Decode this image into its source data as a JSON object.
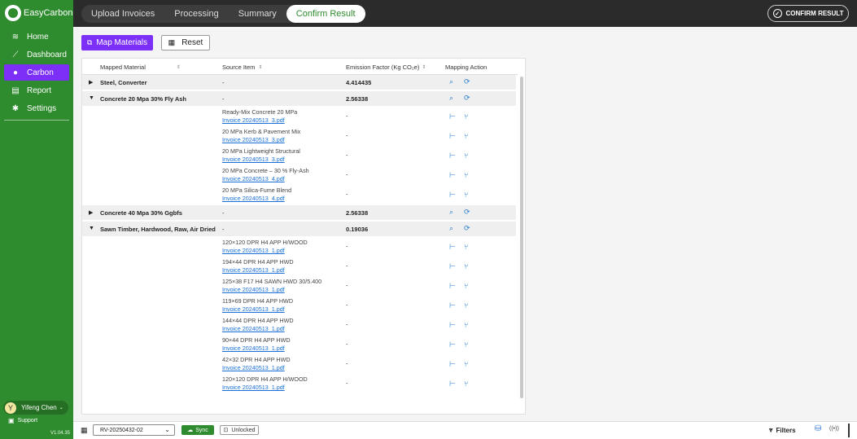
{
  "app": {
    "name": "EasyCarbon",
    "version": "V1.04.35"
  },
  "sidebar": {
    "items": [
      {
        "label": "Home",
        "icon": "layers-icon"
      },
      {
        "label": "Dashboard",
        "icon": "chart-line-icon"
      },
      {
        "label": "Carbon",
        "icon": "droplet-icon",
        "active": true
      },
      {
        "label": "Report",
        "icon": "document-icon"
      },
      {
        "label": "Settings",
        "icon": "gear-icon"
      }
    ],
    "user": {
      "initial": "Y",
      "name": "Yifeng Chen"
    },
    "support_label": "Support"
  },
  "header": {
    "tabs": [
      {
        "label": "Upload Invoices"
      },
      {
        "label": "Processing"
      },
      {
        "label": "Summary"
      },
      {
        "label": "Confirm Result",
        "active": true
      }
    ],
    "confirm_button": "CONFIRM RESULT"
  },
  "toolbar": {
    "map_materials": "Map Materials",
    "reset": "Reset"
  },
  "table": {
    "columns": {
      "mapped_material": "Mapped Material",
      "source_item": "Source Item",
      "emission_factor": "Emission Factor (Kg CO₂e)",
      "mapping_action": "Mapping Action"
    },
    "groups": [
      {
        "material": "Steel, Converter",
        "source": "-",
        "factor": "4.414435",
        "expanded": false,
        "items": []
      },
      {
        "material": "Concrete 20 Mpa 30% Fly Ash",
        "source": "-",
        "factor": "2.56338",
        "expanded": true,
        "items": [
          {
            "name": "Ready-Mix Concrete 20 MPa",
            "invoice": "Invoice 20240513_3.pdf",
            "factor": "-"
          },
          {
            "name": "20 MPa Kerb & Pavement Mix",
            "invoice": "Invoice 20240513_3.pdf",
            "factor": "-"
          },
          {
            "name": "20 MPa Lightweight Structural",
            "invoice": "Invoice 20240513_3.pdf",
            "factor": "-"
          },
          {
            "name": "20 MPa Concrete – 30 % Fly-Ash",
            "invoice": "Invoice 20240513_4.pdf",
            "factor": "-"
          },
          {
            "name": "20 MPa Silica-Fume Blend",
            "invoice": "Invoice 20240513_4.pdf",
            "factor": "-"
          }
        ]
      },
      {
        "material": "Concrete 40 Mpa 30% Ggbfs",
        "source": "-",
        "factor": "2.56338",
        "expanded": false,
        "items": []
      },
      {
        "material": "Sawn Timber, Hardwood, Raw, Air Dried",
        "source": "-",
        "factor": "0.19036",
        "expanded": true,
        "items": [
          {
            "name": "120×120 DPR H4 APP H/WOOD",
            "invoice": "Invoice 20240513_1.pdf",
            "factor": "-"
          },
          {
            "name": "194×44 DPR H4 APP HWD",
            "invoice": "Invoice 20240513_1.pdf",
            "factor": "-"
          },
          {
            "name": "125×38 F17 H4 SAWN HWD 30/5.400",
            "invoice": "Invoice 20240513_1.pdf",
            "factor": "-"
          },
          {
            "name": "119×69 DPR H4 APP HWD",
            "invoice": "Invoice 20240513_1.pdf",
            "factor": "-"
          },
          {
            "name": "144×44 DPR H4 APP HWD",
            "invoice": "Invoice 20240513_1.pdf",
            "factor": "-"
          },
          {
            "name": "90×44 DPR H4 APP HWD",
            "invoice": "Invoice 20240513_1.pdf",
            "factor": "-"
          },
          {
            "name": "42×32 DPR H4 APP HWD",
            "invoice": "Invoice 20240513_1.pdf",
            "factor": "-"
          },
          {
            "name": "120×120 DPR H4 APP H/WOOD",
            "invoice": "Invoice 20240513_1.pdf",
            "factor": "-"
          }
        ]
      }
    ]
  },
  "bottombar": {
    "revision": "RV-20250432-02",
    "sync": "Sync",
    "lock_status": "Unlocked",
    "filters": "Filters"
  },
  "colors": {
    "brand_green": "#2e8b2e",
    "accent_purple": "#7b2ff7",
    "link_blue": "#1a6fd6"
  }
}
